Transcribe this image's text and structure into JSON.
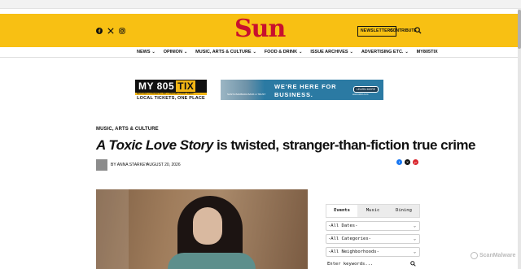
{
  "header": {
    "logo": "Sun",
    "newsletters": "NEWSLETTERS",
    "contribute": "CONTRIBUTE",
    "social_icons": [
      "facebook-icon",
      "x-icon",
      "instagram-icon"
    ],
    "colors": {
      "header_bg": "#f8c013",
      "logo": "#c8102e"
    }
  },
  "nav": {
    "items": [
      {
        "label": "NEWS",
        "dropdown": true
      },
      {
        "label": "OPINION",
        "dropdown": true
      },
      {
        "label": "MUSIC, ARTS & CULTURE",
        "dropdown": true
      },
      {
        "label": "FOOD & DRINK",
        "dropdown": true
      },
      {
        "label": "ISSUE ARCHIVES",
        "dropdown": true
      },
      {
        "label": "ADVERTISING ETC.",
        "dropdown": true
      },
      {
        "label": "MY805TIX",
        "dropdown": false
      }
    ]
  },
  "ads": {
    "ad1": {
      "title_a": "MY 805",
      "title_b": "TIX",
      "categories": "FESTIVALS • CONCERTS • ART • THEATRE • FOOD • DRINK",
      "tagline": "LOCAL TICKETS, ONE PLACE"
    },
    "ad2": {
      "bank": "SANTA BARBARA BANK & TRUST",
      "line1": "WE'RE HERE FOR",
      "line2": "BUSINESS.",
      "button": "LEARN MORE",
      "url": "www.sbbt.com"
    }
  },
  "article": {
    "kicker": "MUSIC, ARTS & CULTURE",
    "title_italic": "A Toxic Love Story",
    "title_rest": " is twisted, stranger-than-fiction true crime",
    "byline": "BY ANNA STARKEY",
    "date": "AUGUST 20, 2026",
    "share_colors": [
      "#1877f2",
      "#111111",
      "#d9252d"
    ]
  },
  "widget": {
    "tabs": [
      {
        "label": "Events",
        "active": true
      },
      {
        "label": "Music",
        "active": false
      },
      {
        "label": "Dining",
        "active": false
      }
    ],
    "dates": "-All Dates-",
    "categories": "-All Categories-",
    "neighborhoods": "-All Neighborhoods-",
    "keywords_placeholder": "Enter keywords..."
  },
  "watermark": "ScanMalware"
}
